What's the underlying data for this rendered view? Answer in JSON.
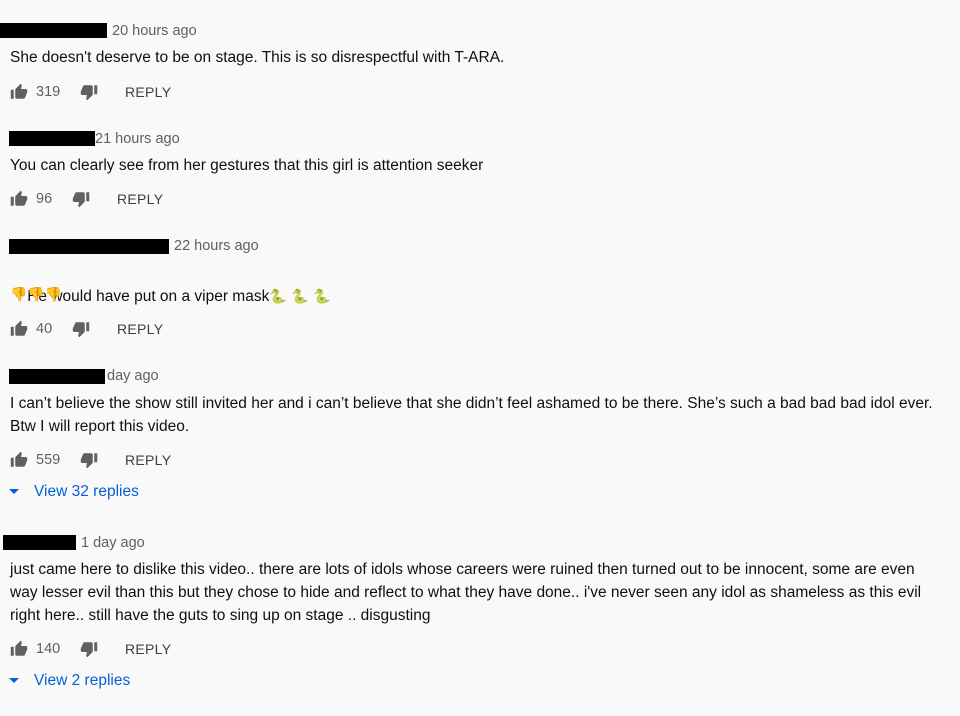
{
  "comments": [
    {
      "time": "20 hours ago",
      "text": "She doesn't deserve to be on stage. This is so disrespectful with T-ARA.",
      "likes": "319",
      "reply_label": "REPLY"
    },
    {
      "time": "21 hours ago",
      "text": "You can clearly see from her gestures that this girl is attention seeker",
      "likes": "96",
      "reply_label": "REPLY"
    },
    {
      "time": "22 hours ago",
      "text": "He would have put on a viper mask",
      "emoji_line1": "🐍 🐍 🐍",
      "emoji_line2": "👎👎👎",
      "likes": "40",
      "reply_label": "REPLY"
    },
    {
      "time": "day ago",
      "text": "I can’t believe the show still invited her and i can’t believe that she didn’t feel ashamed to be there. She’s such a bad bad bad idol ever. Btw I will report this video.",
      "likes": "559",
      "reply_label": "REPLY",
      "view_replies": "View 32 replies"
    },
    {
      "time": "1 day ago",
      "text": "just came here to dislike this video.. there are lots of idols whose careers were ruined then turned out to be innocent, some are even way lesser evil than this but they chose to hide and reflect to what they have done.. i've never seen any idol as shameless as this evil right here.. still have the guts to sing up on stage .. disgusting",
      "likes": "140",
      "reply_label": "REPLY",
      "view_replies": "View 2 replies"
    }
  ],
  "icons": {
    "like": "thumb-up-icon",
    "dislike": "thumb-down-icon",
    "expand": "caret-down-icon"
  },
  "colors": {
    "background": "#f9f9f9",
    "text": "#0f0f0f",
    "muted": "#606060",
    "link": "#065fd4",
    "redaction": "#000000"
  }
}
